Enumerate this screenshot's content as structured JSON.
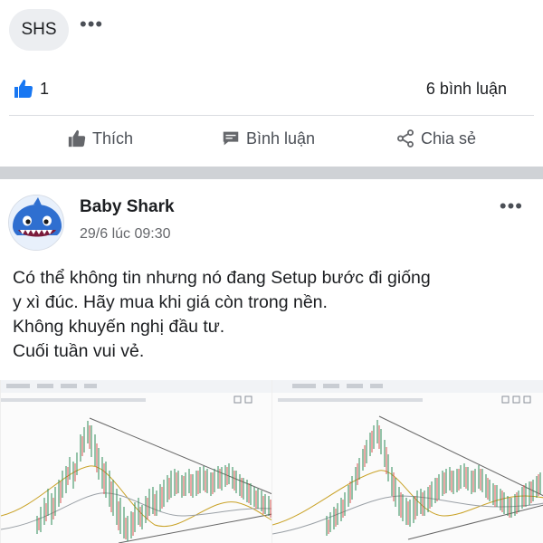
{
  "top_post": {
    "chip_label": "SHS",
    "more_icon": "ellipsis-icon",
    "like_count": "1",
    "comment_count": "6 bình luận",
    "actions": {
      "like_label": "Thích",
      "comment_label": "Bình luận",
      "share_label": "Chia sẻ"
    }
  },
  "post2": {
    "author": "Baby Shark",
    "timestamp": "29/6 lúc 09:30",
    "text_lines": [
      "Có thể không tin nhưng nó đang Setup bước đi giống",
      "y xì đúc. Hãy mua khi giá còn trong nền.",
      "Không khuyến nghị đầu tư.",
      "Cuối tuần vui vẻ."
    ],
    "attachments": [
      {
        "name": "stock-chart-1"
      },
      {
        "name": "stock-chart-2"
      }
    ]
  },
  "colors": {
    "accent_blue": "#1877f2",
    "text": "#1c1e21",
    "muted": "#65676b",
    "separator": "#cfd2d6"
  }
}
